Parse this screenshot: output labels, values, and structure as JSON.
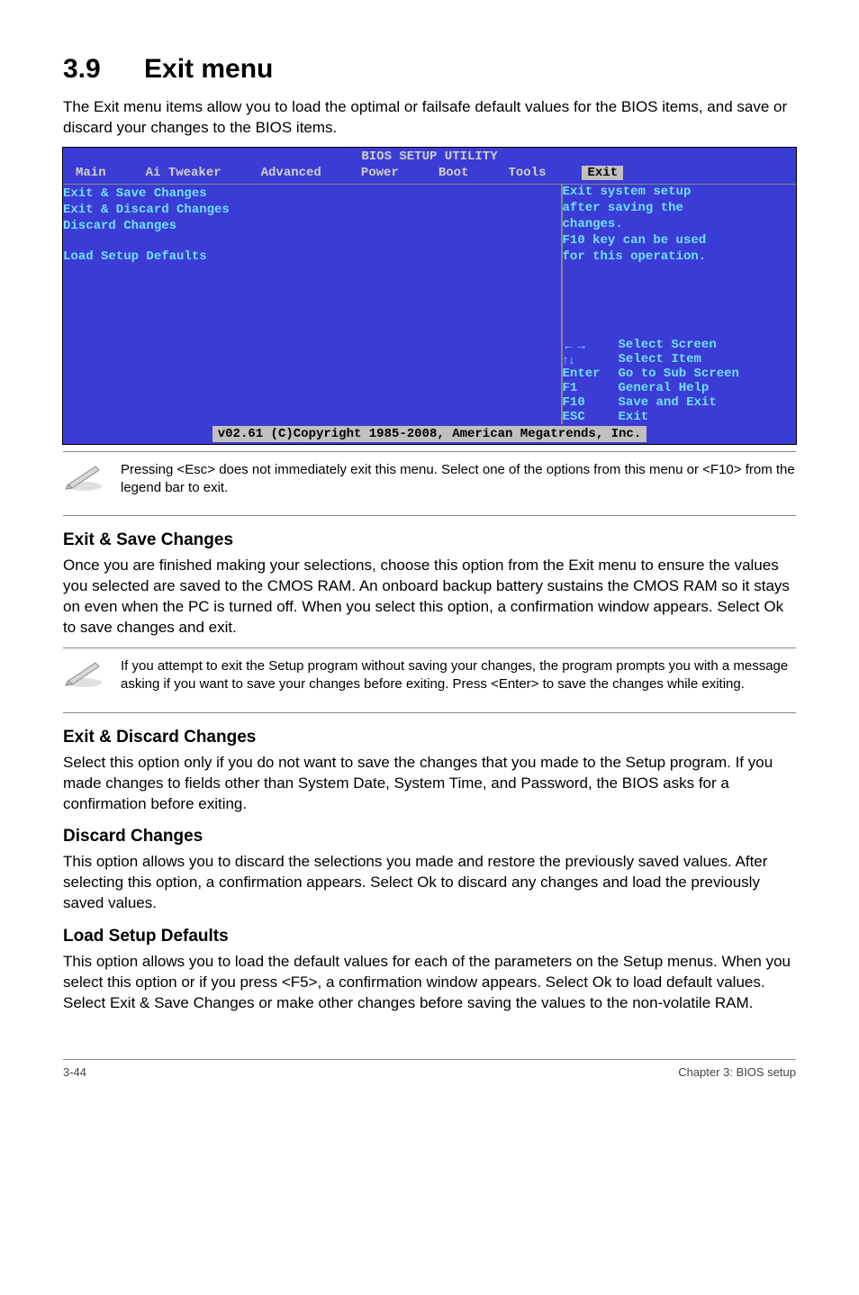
{
  "section_number": "3.9",
  "section_title": "Exit menu",
  "intro": "The Exit menu items allow you to load the optimal or failsafe default values for the BIOS items, and save or discard your changes to the BIOS items.",
  "bios": {
    "title": "BIOS SETUP UTILITY",
    "tabs": [
      "Main",
      "Ai Tweaker",
      "Advanced",
      "Power",
      "Boot",
      "Tools",
      "Exit"
    ],
    "active_tab": "Exit",
    "left_items": [
      "Exit & Save Changes",
      "Exit & Discard Changes",
      "Discard Changes",
      "",
      "Load Setup Defaults"
    ],
    "help_lines": [
      "Exit system setup",
      "after saving the",
      "changes."
    ],
    "help2_lines": [
      "F10 key can be used",
      "for this operation."
    ],
    "nav": [
      {
        "key": "←→",
        "label": "Select Screen"
      },
      {
        "key": "↑↓",
        "label": "Select Item"
      },
      {
        "key": "Enter",
        "label": "Go to Sub Screen"
      },
      {
        "key": "F1",
        "label": "General Help"
      },
      {
        "key": "F10",
        "label": "Save and Exit"
      },
      {
        "key": "ESC",
        "label": "Exit"
      }
    ],
    "footer": "v02.61 (C)Copyright 1985-2008, American Megatrends, Inc."
  },
  "note1": "Pressing <Esc> does not immediately exit this menu. Select one of the options from this menu or <F10> from the legend bar to exit.",
  "sections": {
    "save": {
      "title": "Exit & Save Changes",
      "body": "Once you are finished making your selections, choose this option from the Exit menu to ensure the values you selected are saved to the CMOS RAM. An onboard backup battery sustains the CMOS RAM so it stays on even when the PC is turned off. When you select this option, a confirmation window appears. Select Ok to save changes and exit."
    },
    "note2": "If you attempt to exit the Setup program without saving your changes, the program prompts you with a message asking if you want to save your changes before exiting. Press <Enter> to save the changes while exiting.",
    "discard_exit": {
      "title": "Exit & Discard Changes",
      "body": "Select this option only if you do not want to save the changes that you  made to the Setup program. If you made changes to fields other than System Date, System Time, and Password, the BIOS asks for a confirmation before exiting."
    },
    "discard": {
      "title": "Discard Changes",
      "body": "This option allows you to discard the selections you made and restore the previously saved values. After selecting this option, a confirmation appears. Select Ok to discard any changes and load the previously saved values."
    },
    "defaults": {
      "title": "Load Setup Defaults",
      "body": "This option allows you to load the default values for each of the parameters on the Setup menus. When you select this option or if you press <F5>, a confirmation window appears. Select Ok to load default values. Select Exit & Save Changes or make other changes before saving the values to the non-volatile RAM."
    }
  },
  "footer_left": "3-44",
  "footer_right": "Chapter 3: BIOS setup"
}
